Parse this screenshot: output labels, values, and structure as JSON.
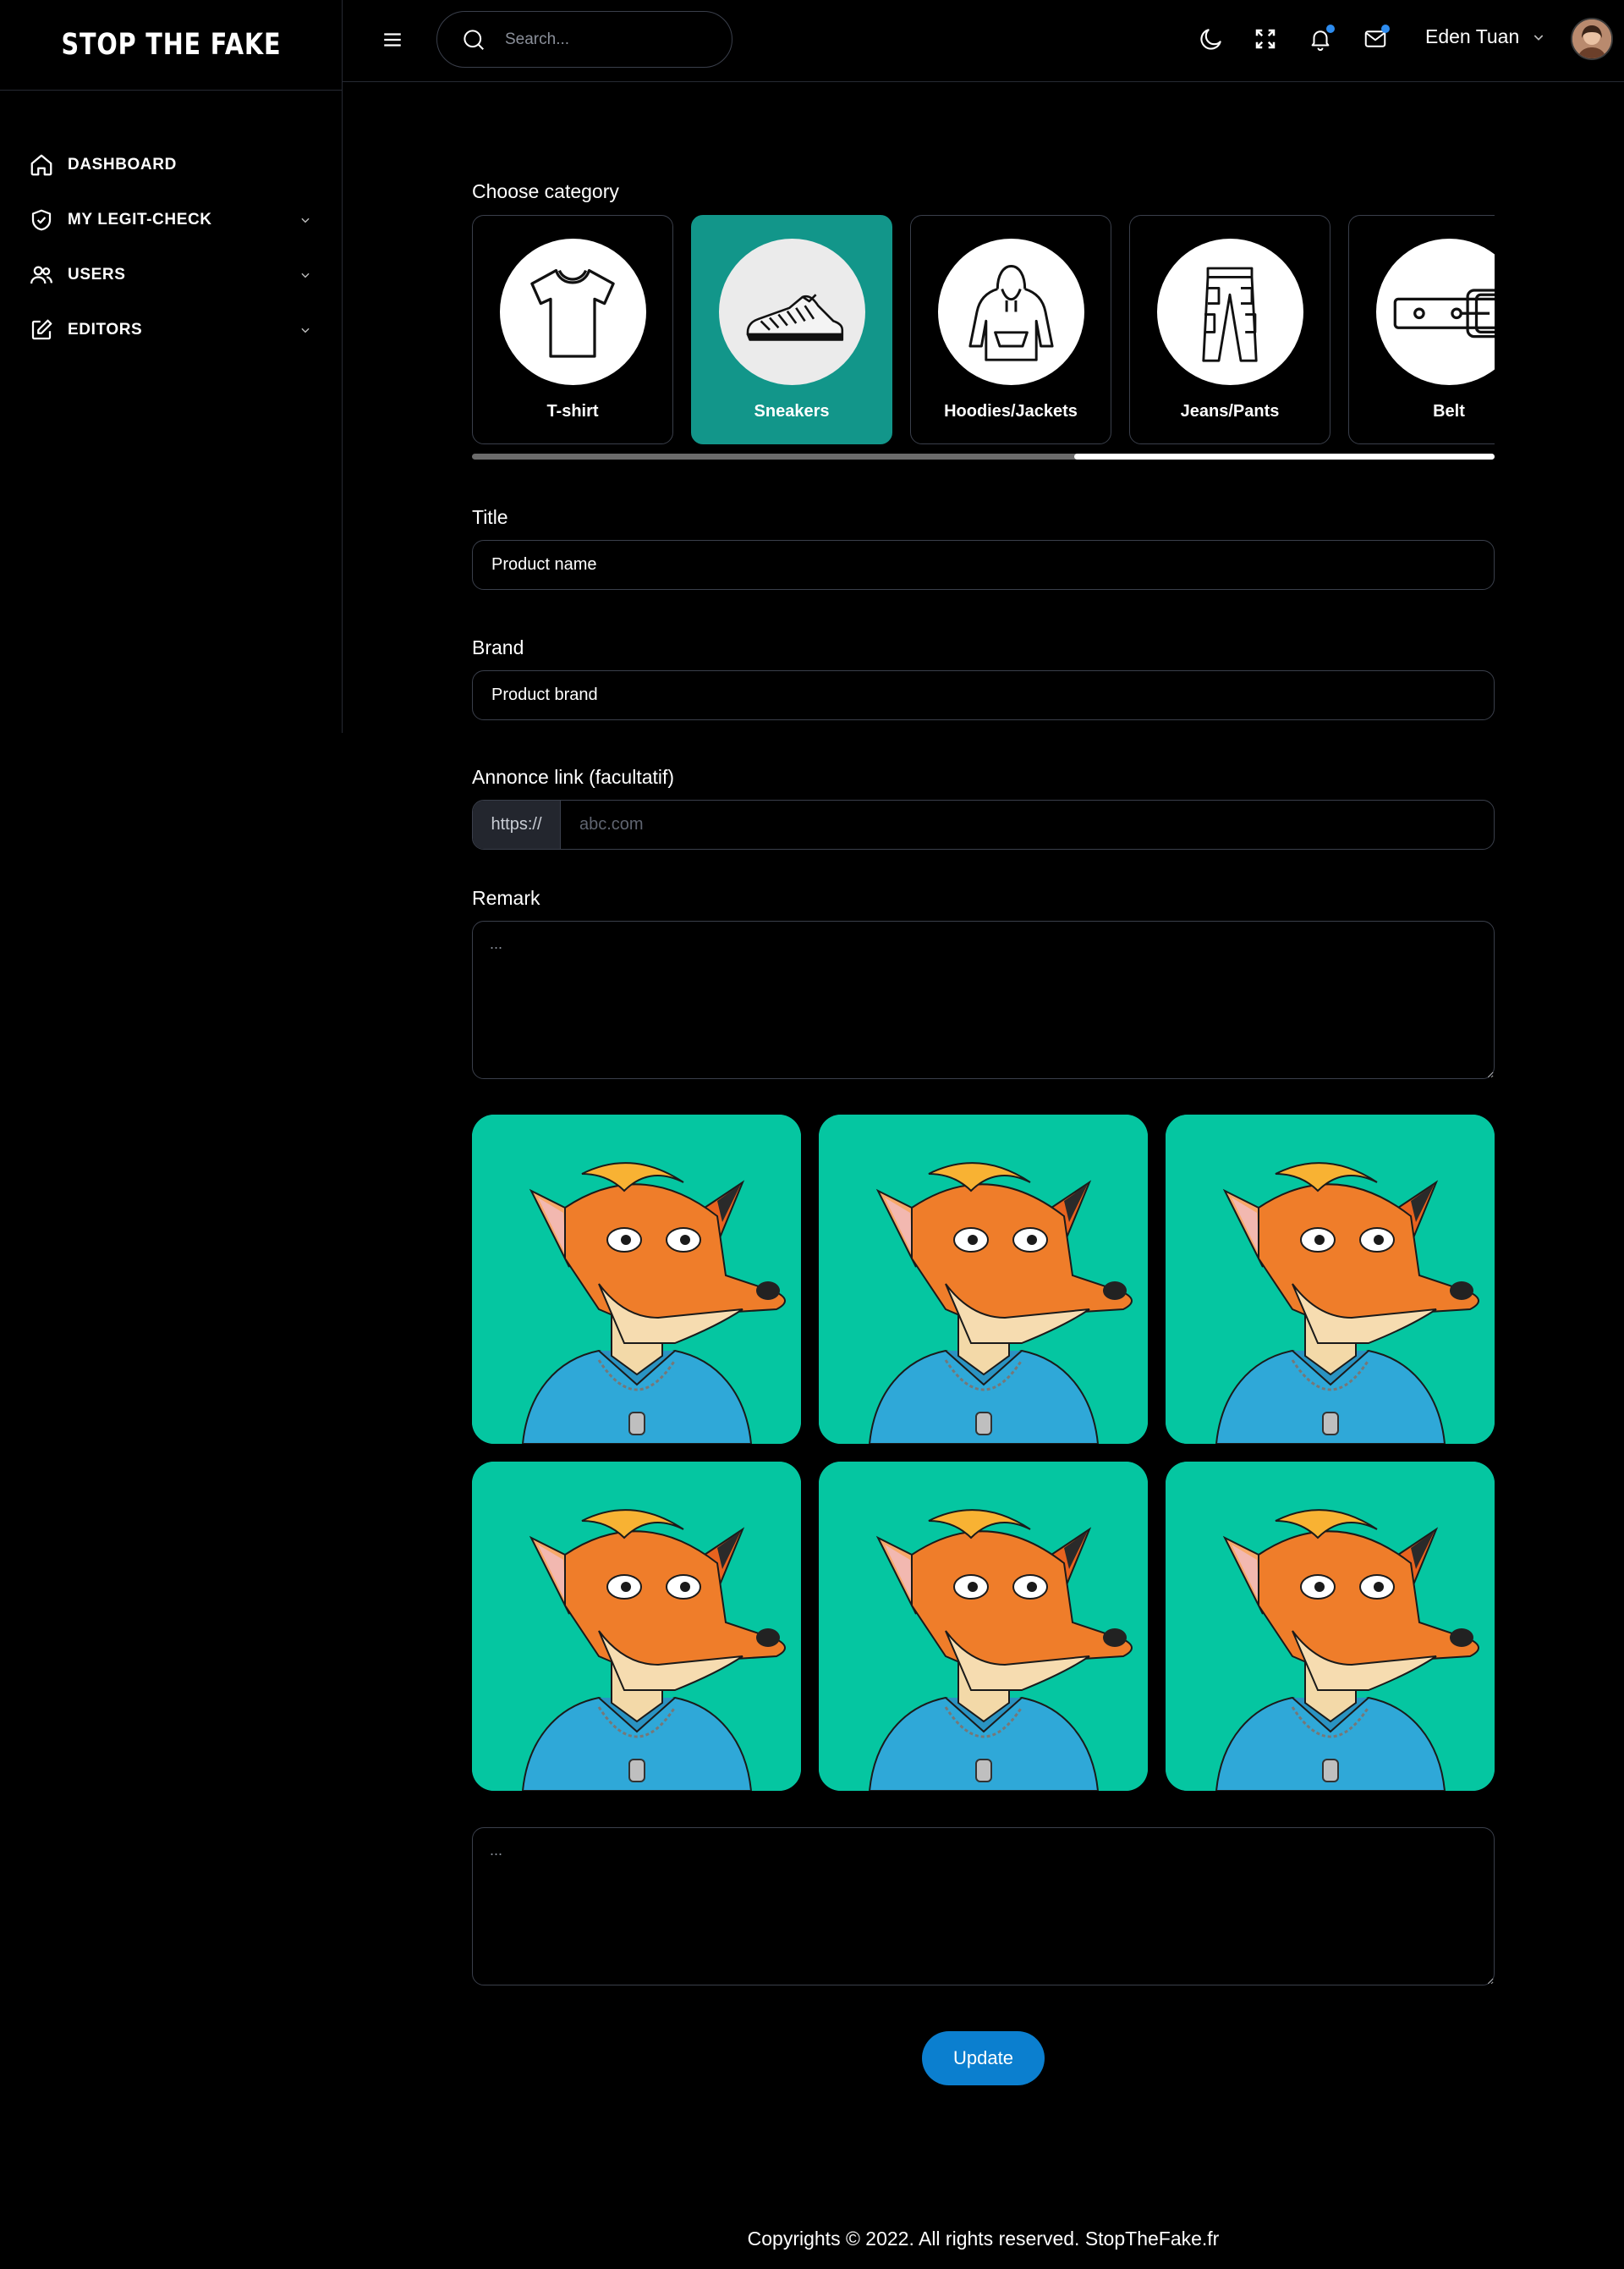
{
  "brand": {
    "logo_text": "STOP THE FAKE"
  },
  "sidebar": {
    "items": [
      {
        "label": "DASHBOARD",
        "icon": "home-icon",
        "has_chevron": false
      },
      {
        "label": "MY LEGIT-CHECK",
        "icon": "shield-check-icon",
        "has_chevron": true
      },
      {
        "label": "USERS",
        "icon": "users-icon",
        "has_chevron": true
      },
      {
        "label": "EDITORS",
        "icon": "edit-icon",
        "has_chevron": true
      }
    ]
  },
  "header": {
    "search_placeholder": "Search...",
    "user_name": "Eden Tuan",
    "icons": [
      "menu-icon",
      "search-icon",
      "moon-icon",
      "fullscreen-icon",
      "bell-icon",
      "mail-icon",
      "chevron-down-icon"
    ]
  },
  "form": {
    "category_label": "Choose category",
    "categories": [
      {
        "label": "T-shirt",
        "icon": "tshirt-icon",
        "active": false
      },
      {
        "label": "Sneakers",
        "icon": "sneaker-icon",
        "active": true
      },
      {
        "label": "Hoodies/Jackets",
        "icon": "hoodie-icon",
        "active": false
      },
      {
        "label": "Jeans/Pants",
        "icon": "pants-icon",
        "active": false
      },
      {
        "label": "Belt",
        "icon": "belt-icon",
        "active": false
      }
    ],
    "title_label": "Title",
    "title_value": "Product name",
    "brand_label": "Brand",
    "brand_value": "Product brand",
    "link_label": "Annonce link (facultatif)",
    "link_prefix": "https://",
    "link_placeholder": "abc.com",
    "remark_label": "Remark",
    "remark_placeholder": "...",
    "comment_placeholder": "...",
    "images_count": 6,
    "update_label": "Update"
  },
  "colors": {
    "accent_teal": "#12968a",
    "image_bg": "#05c6a1",
    "button_blue": "#0b7fcf",
    "notification_dot": "#2d8cf0"
  },
  "footer": {
    "text": "Copyrights © 2022. All rights reserved. StopTheFake.fr"
  }
}
